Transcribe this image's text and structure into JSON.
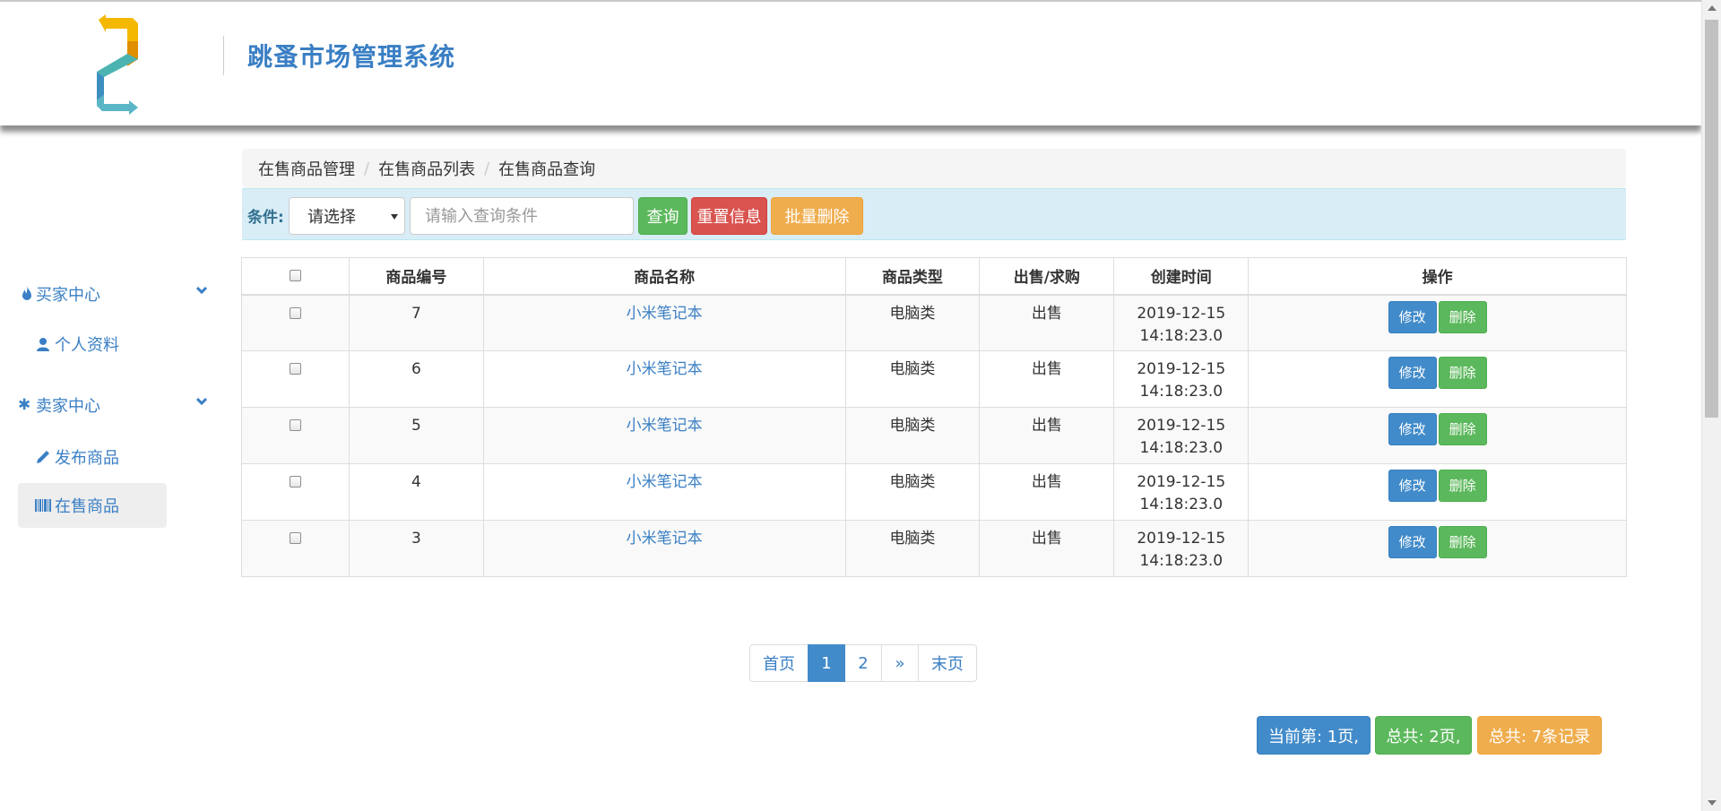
{
  "header": {
    "title": "跳蚤市场管理系统",
    "logo_icon": "logo-arrows-icon"
  },
  "sidebar": {
    "groups": [
      {
        "label": "买家中心",
        "icon": "fire-icon",
        "items": [
          {
            "label": "个人资料",
            "icon": "user-icon"
          }
        ]
      },
      {
        "label": "卖家中心",
        "icon": "asterisk-icon",
        "items": [
          {
            "label": "发布商品",
            "icon": "pencil-icon"
          },
          {
            "label": "在售商品",
            "icon": "barcode-icon",
            "active": true
          }
        ]
      }
    ]
  },
  "breadcrumb": [
    "在售商品管理",
    "在售商品列表",
    "在售商品查询"
  ],
  "query": {
    "label": "条件:",
    "select_value": "请选择",
    "input_placeholder": "请输入查询条件",
    "search_label": "查询",
    "reset_label": "重置信息",
    "batch_delete_label": "批量删除"
  },
  "table": {
    "headers": [
      "商品编号",
      "商品名称",
      "商品类型",
      "出售/求购",
      "创建时间",
      "操作"
    ],
    "rows": [
      {
        "id": "7",
        "name": "小米笔记本",
        "type": "电脑类",
        "trade": "出售",
        "date": "2019-12-15",
        "time": "14:18:23.0"
      },
      {
        "id": "6",
        "name": "小米笔记本",
        "type": "电脑类",
        "trade": "出售",
        "date": "2019-12-15",
        "time": "14:18:23.0"
      },
      {
        "id": "5",
        "name": "小米笔记本",
        "type": "电脑类",
        "trade": "出售",
        "date": "2019-12-15",
        "time": "14:18:23.0"
      },
      {
        "id": "4",
        "name": "小米笔记本",
        "type": "电脑类",
        "trade": "出售",
        "date": "2019-12-15",
        "time": "14:18:23.0"
      },
      {
        "id": "3",
        "name": "小米笔记本",
        "type": "电脑类",
        "trade": "出售",
        "date": "2019-12-15",
        "time": "14:18:23.0"
      }
    ],
    "edit_label": "修改",
    "delete_label": "删除"
  },
  "pagination": {
    "first": "首页",
    "pages": [
      "1",
      "2"
    ],
    "current": "1",
    "next": "»",
    "last": "末页"
  },
  "page_info": {
    "current": "当前第: 1页,",
    "total_pages": "总共: 2页,",
    "total_records": "总共: 7条记录"
  },
  "colors": {
    "primary": "#428bca",
    "success": "#5cb85c",
    "danger": "#d9534f",
    "warning": "#f0ad4e",
    "title": "#3a7fc4"
  }
}
